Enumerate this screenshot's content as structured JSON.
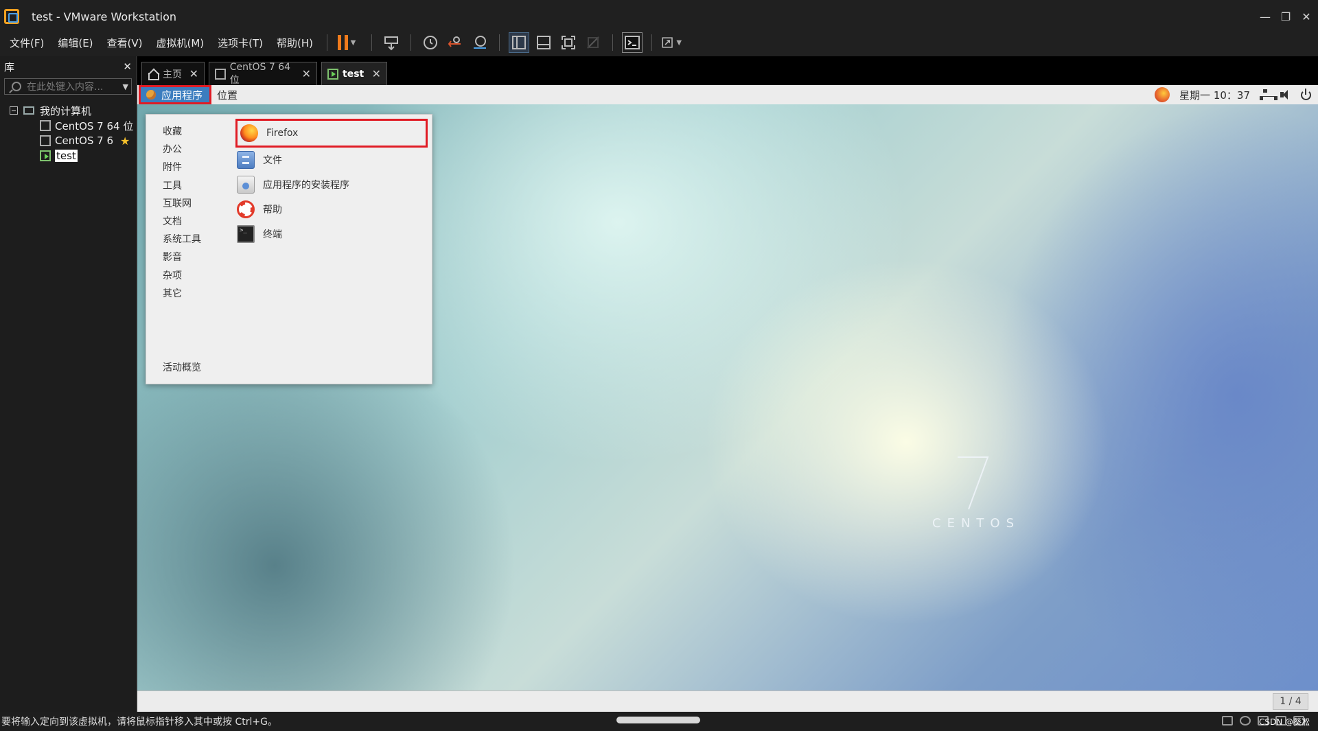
{
  "window": {
    "title": "test - VMware Workstation",
    "minimize": "—",
    "restore": "❐",
    "close": "✕"
  },
  "menu": {
    "file": "文件(F)",
    "edit": "编辑(E)",
    "view": "查看(V)",
    "vm": "虚拟机(M)",
    "tabs": "选项卡(T)",
    "help": "帮助(H)"
  },
  "library": {
    "title": "库",
    "close": "✕",
    "search_placeholder": "在此处键入内容...",
    "root": "我的计算机",
    "vms": [
      "CentOS 7 64 位",
      "CentOS 7 6",
      "test"
    ]
  },
  "tabs": [
    {
      "label": "主页"
    },
    {
      "label": "CentOS 7 64 位"
    },
    {
      "label": "test"
    }
  ],
  "guest": {
    "panel": {
      "applications": "应用程序",
      "places": "位置",
      "clock": "星期一 10：37"
    },
    "categories": [
      "收藏",
      "办公",
      "附件",
      "工具",
      "互联网",
      "文档",
      "系统工具",
      "影音",
      "杂项",
      "其它"
    ],
    "activities": "活动概览",
    "apps": [
      {
        "name": "Firefox",
        "icon": "firefox-icon"
      },
      {
        "name": "文件",
        "icon": "files-icon"
      },
      {
        "name": "应用程序的安装程序",
        "icon": "software-installer-icon"
      },
      {
        "name": "帮助",
        "icon": "help-lifebuoy-icon"
      },
      {
        "name": "终端",
        "icon": "terminal-icon"
      }
    ],
    "watermark": {
      "number": "7",
      "word": "CENTOS"
    },
    "pager": "1 / 4"
  },
  "status": {
    "message": "要将输入定向到该虚拟机，请将鼠标指针移入其中或按 Ctrl+G。",
    "credit": "CSDN @葵凇"
  },
  "colors": {
    "highlight_border": "#e01b24",
    "apps_menu_bg": "#3b7dbf",
    "pause": "#f07b1c"
  }
}
